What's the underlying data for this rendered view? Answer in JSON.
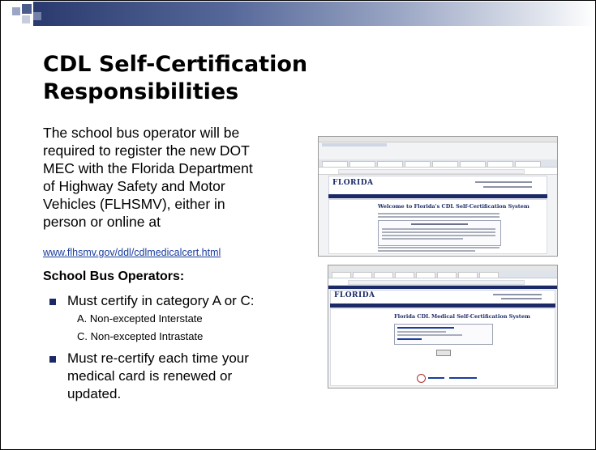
{
  "title_line1": "CDL Self-Certification",
  "title_line2": "Responsibilities",
  "body": {
    "line1": "The school bus operator will be",
    "line2": "required to register the new DOT",
    "line3": "MEC with the Florida Department",
    "line4": "of Highway Safety and Motor",
    "line5": "Vehicles (FLHSMV), either in",
    "line6": "person or online at"
  },
  "link": "www.flhsmv.gov/ddl/cdlmedicalcert.html",
  "subheading": "School Bus Operators:",
  "bullets": {
    "b1": "Must certify in category A or C:",
    "b1_sub1": "A. Non-excepted Interstate",
    "b1_sub2": "C. Non-excepted Intrastate",
    "b2_line1": "Must re-certify each time your",
    "b2_line2": "medical card is renewed or",
    "b2_line3": "updated."
  },
  "colors": {
    "title": "#000000",
    "bullet": "#1b2a66",
    "link": "#1a3d9e",
    "header_bar_start": "#2a3a6e"
  },
  "screenshots": {
    "top": {
      "logo": "FLORIDA",
      "heading": "Welcome to Florida's CDL Self-Certification System"
    },
    "bottom": {
      "logo": "FLORIDA",
      "heading": "Florida CDL Medical Self-Certification System"
    }
  }
}
